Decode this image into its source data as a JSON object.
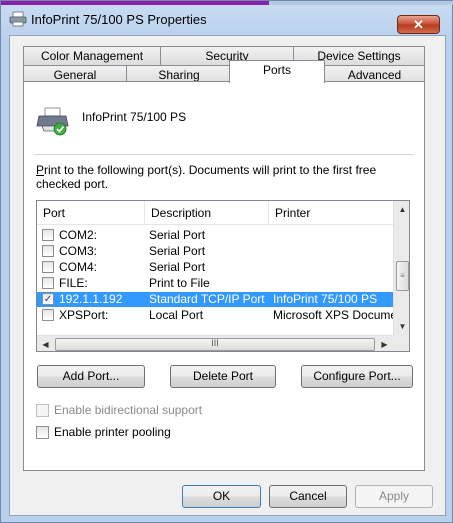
{
  "window": {
    "title": "InfoPrint 75/100 PS Properties",
    "close_label": "✕"
  },
  "tabs_row1": [
    {
      "label": "Color Management"
    },
    {
      "label": "Security"
    },
    {
      "label": "Device Settings"
    }
  ],
  "tabs_row2": [
    {
      "label": "General"
    },
    {
      "label": "Sharing"
    },
    {
      "label": "Ports",
      "active": true
    },
    {
      "label": "Advanced"
    }
  ],
  "ports_tab": {
    "printer_name": "InfoPrint 75/100 PS",
    "instruction_underlined": "P",
    "instruction_rest": "rint to the following port(s). Documents will print to the first free checked port.",
    "columns": [
      "Port",
      "Description",
      "Printer"
    ],
    "rows": [
      {
        "port": "COM2:",
        "description": "Serial Port",
        "printer": "",
        "checked": false,
        "selected": false
      },
      {
        "port": "COM3:",
        "description": "Serial Port",
        "printer": "",
        "checked": false,
        "selected": false
      },
      {
        "port": "COM4:",
        "description": "Serial Port",
        "printer": "",
        "checked": false,
        "selected": false
      },
      {
        "port": "FILE:",
        "description": "Print to File",
        "printer": "",
        "checked": false,
        "selected": false
      },
      {
        "port": "192.1.1.192",
        "description": "Standard TCP/IP Port",
        "printer": "InfoPrint 75/100 PS",
        "checked": true,
        "selected": true
      },
      {
        "port": "XPSPort:",
        "description": "Local Port",
        "printer": "Microsoft XPS Documen",
        "checked": false,
        "selected": false
      }
    ],
    "add_port": "Add Port...",
    "delete_port": "Delete Port",
    "configure_port": "Configure Port...",
    "bidirectional": {
      "label": "Enable bidirectional support",
      "checked": false,
      "enabled": false
    },
    "pooling": {
      "label": "Enable printer pooling",
      "checked": false,
      "enabled": true
    }
  },
  "buttons": {
    "ok": "OK",
    "cancel": "Cancel",
    "apply": "Apply"
  },
  "colors": {
    "selection": "#3399ff",
    "title_gradient": "#b9d0ec"
  }
}
